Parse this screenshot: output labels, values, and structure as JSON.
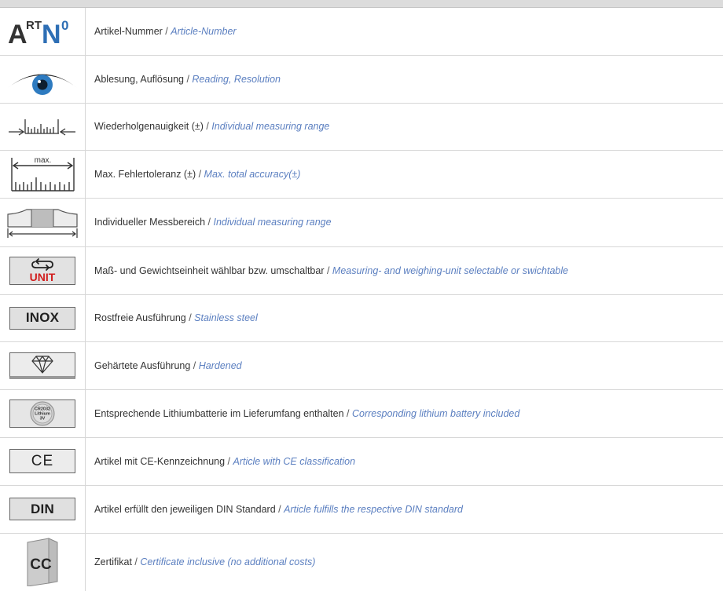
{
  "colors": {
    "german_text": "#333333",
    "english_text": "#5b7fc0",
    "unit_red": "#d11e1e",
    "eye_blue": "#2e7bc0",
    "rule": "#d7d7d7"
  },
  "icon_texts": {
    "artno_a": "A",
    "artno_rt": "RT",
    "artno_n": "N",
    "artno_o": "0",
    "max": "max.",
    "unit": "UNIT",
    "inox": "INOX",
    "battery_l1": "CR2032",
    "battery_l2": "Lithium",
    "battery_l3": "3V",
    "ce": "CE",
    "din": "DIN",
    "cc": "CC"
  },
  "rows": [
    {
      "icon": "article-number-icon",
      "de": "Artikel-Nummer",
      "sep": " / ",
      "en": "Article-Number"
    },
    {
      "icon": "eye-icon",
      "de": "Ablesung, Auflösung",
      "sep": " / ",
      "en": "Reading, Resolution"
    },
    {
      "icon": "repeatability-scale-icon",
      "de": "Wiederholgenauigkeit (±)",
      "sep": " / ",
      "en": "Individual measuring range"
    },
    {
      "icon": "max-tolerance-icon",
      "de": "Max. Fehlertoleranz (±)",
      "sep": " / ",
      "en": "Max. total accuracy(±)"
    },
    {
      "icon": "measuring-range-icon",
      "de": "Individueller Messbereich",
      "sep": " / ",
      "en": "Individual measuring range"
    },
    {
      "icon": "unit-switch-icon",
      "de": "Maß- und Gewichtseinheit wählbar bzw. umschaltbar",
      "sep": " / ",
      "en": "Measuring- and weighing-unit selectable or swichtable"
    },
    {
      "icon": "inox-icon",
      "de": "Rostfreie Ausführung",
      "sep": " / ",
      "en": "Stainless steel"
    },
    {
      "icon": "diamond-icon",
      "de": "Gehärtete Ausführung",
      "sep": " / ",
      "en": "Hardened"
    },
    {
      "icon": "battery-icon",
      "de": "Entsprechende Lithiumbatterie im Lieferumfang enthalten",
      "sep": " / ",
      "en": "Corresponding lithium battery included"
    },
    {
      "icon": "ce-mark-icon",
      "de": "Artikel mit CE-Kennzeichnung",
      "sep": " / ",
      "en": "Article with CE classification"
    },
    {
      "icon": "din-icon",
      "de": "Artikel erfüllt den jeweiligen DIN Standard",
      "sep": " / ",
      "en": "Article fulfills the respective DIN standard"
    },
    {
      "icon": "certificate-icon",
      "de": "Zertifikat",
      "sep": " / ",
      "en": "Certificate inclusive (no additional costs)"
    }
  ]
}
